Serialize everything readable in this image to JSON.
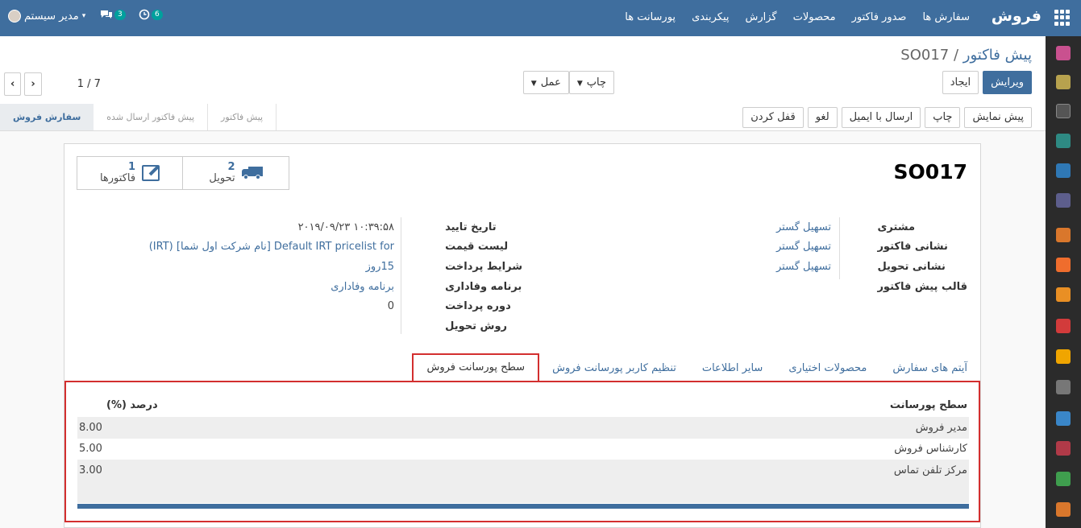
{
  "topbar": {
    "app_name": "فروش",
    "menu": [
      "سفارش ها",
      "صدور فاکتور",
      "محصولات",
      "گزارش",
      "پیکربندی",
      "پورسانت ها"
    ],
    "user_name": "مدیر سیستم",
    "messages_count": "3",
    "activities_count": "6"
  },
  "breadcrumb": {
    "parent": "پیش فاکتور",
    "separator": "/",
    "current": "SO017"
  },
  "buttons": {
    "edit": "ویرایش",
    "create": "ایجاد",
    "print": "چاپ",
    "action": "عمل"
  },
  "pager": {
    "value": "1 / 7"
  },
  "status_actions": [
    "پیش نمایش",
    "چاپ",
    "ارسال با ایمیل",
    "لغو",
    "قفل کردن"
  ],
  "status_steps": [
    {
      "label": "سفارش فروش",
      "active": true
    },
    {
      "label": "پیش فاکتور ارسال شده",
      "active": false
    },
    {
      "label": "پیش فاکتور",
      "active": false
    }
  ],
  "smart_buttons": {
    "delivery": {
      "count": "2",
      "label": "تحویل"
    },
    "invoices": {
      "count": "1",
      "label": "فاکتورها"
    }
  },
  "record_title": "SO017",
  "form": {
    "customer_label": "مشتری",
    "customer": "تسهیل گستر",
    "invoice_address_label": "نشانی فاکتور",
    "invoice_address": "تسهیل گستر",
    "delivery_address_label": "نشانی تحویل",
    "delivery_address": "تسهیل گستر",
    "template_label": "قالب پیش فاکتور",
    "confirmation_date_label": "تاریخ تایید",
    "confirmation_date": "۱۰:۳۹:۵۸ ۲۰۱۹/۰۹/۲۳",
    "pricelist_label": "لیست قیمت",
    "pricelist": "Default IRT pricelist for [نام شرکت اول شما] (IRT)",
    "payment_terms_label": "شرایط پرداخت",
    "payment_terms": "15روز",
    "loyalty_label": "برنامه وفاداری",
    "loyalty": "برنامه وفاداری",
    "payment_period_label": "دوره پرداخت",
    "payment_period": "0",
    "delivery_method_label": "روش تحویل"
  },
  "tabs": [
    "آیتم های سفارش",
    "محصولات اختیاری",
    "سایر اطلاعات",
    "تنظیم کاربر پورسانت فروش",
    "سطح پورسانت فروش"
  ],
  "commission_table": {
    "headers": {
      "level": "سطح پورسانت",
      "percent": "درصد (%)"
    },
    "rows": [
      {
        "level": "مدیر فروش",
        "percent": "8.00"
      },
      {
        "level": "کارشناس فروش",
        "percent": "5.00"
      },
      {
        "level": "مرکز تلفن تماس",
        "percent": "3.00"
      }
    ]
  },
  "colors": {
    "brand": "#3f6e9e",
    "highlight": "#d32f2f"
  }
}
